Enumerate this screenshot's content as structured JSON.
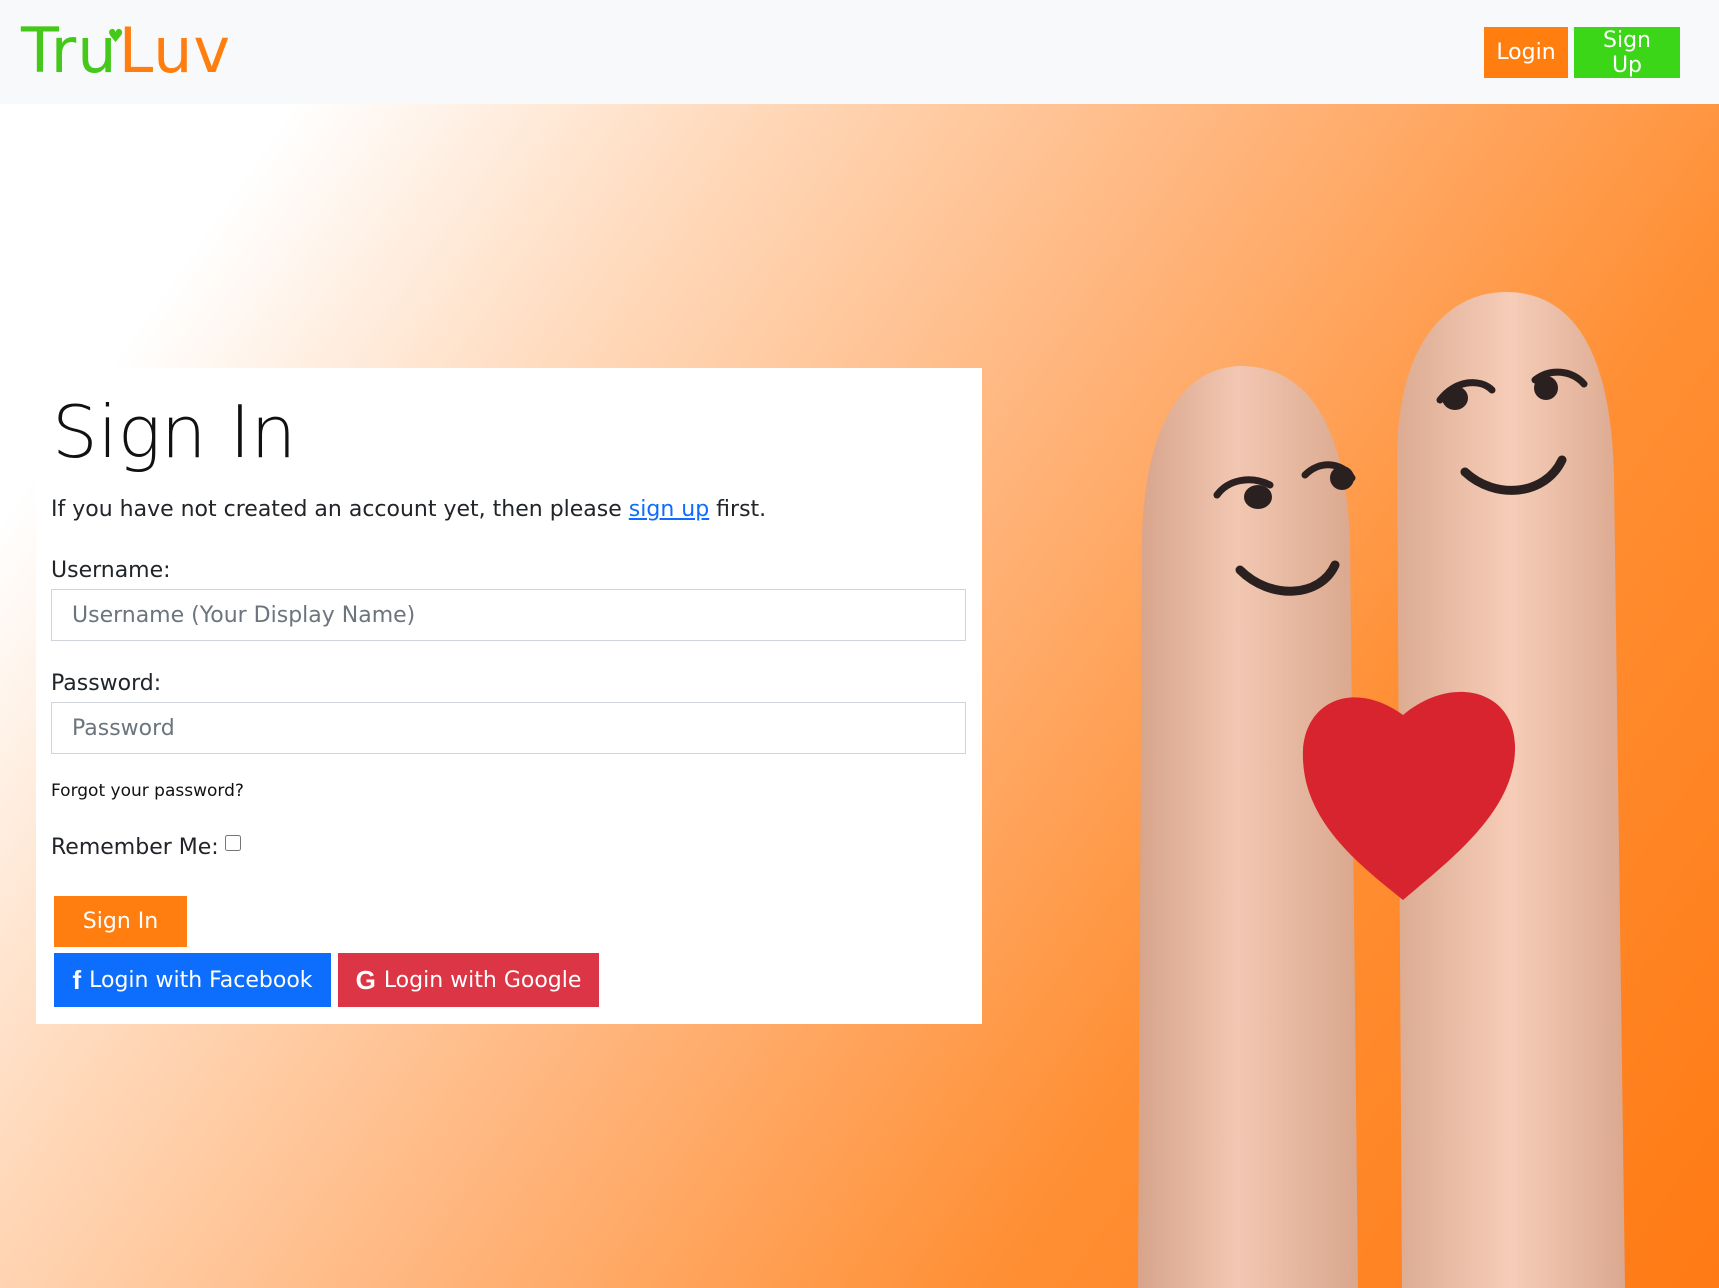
{
  "navbar": {
    "logo": {
      "part1": "Tru",
      "part2": "Luv",
      "heart": "♥"
    },
    "login_label": "Login",
    "signup_label": "Sign Up"
  },
  "signin": {
    "title": "Sign In",
    "intro_before": "If you have not created an account yet, then please ",
    "intro_link": "sign up",
    "intro_after": " first.",
    "username_label": "Username:",
    "username_placeholder": "Username (Your Display Name)",
    "username_value": "",
    "password_label": "Password:",
    "password_placeholder": "Password",
    "password_value": "",
    "forgot_label": "Forgot your password?",
    "remember_label": "Remember Me:",
    "remember_checked": false,
    "submit_label": "Sign In",
    "facebook_label": "Login with Facebook",
    "google_label": "Login with Google",
    "facebook_icon": "f",
    "google_icon": "G"
  },
  "colors": {
    "brand_orange": "#ff7e0f",
    "brand_green": "#3cd618",
    "facebook": "#0d6efd",
    "google": "#dc3545"
  },
  "icons": [
    "facebook-icon",
    "google-icon",
    "heart-icon"
  ]
}
